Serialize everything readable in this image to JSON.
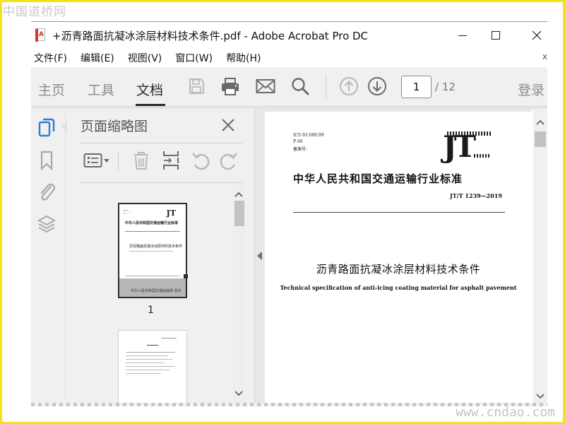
{
  "watermarks": {
    "top_left": "中国道桥网",
    "bottom_right": "www.cndao.com"
  },
  "window": {
    "title": "+沥青路面抗凝冰涂层材料技术条件.pdf - Adobe Acrobat Pro DC",
    "minimize_icon": "minimize-icon",
    "maximize_icon": "maximize-icon",
    "close_icon": "close-icon"
  },
  "menu": {
    "items": [
      "文件(F)",
      "编辑(E)",
      "视图(V)",
      "窗口(W)",
      "帮助(H)"
    ],
    "more": "x"
  },
  "toolbar": {
    "tabs": [
      "主页",
      "工具",
      "文档"
    ],
    "active_tab": "文档",
    "icons": [
      "save-icon",
      "print-icon",
      "email-icon",
      "search-icon",
      "page-up-icon",
      "page-down-icon"
    ],
    "current_page": "1",
    "page_total": "/ 12",
    "login": "登录"
  },
  "left_rail": {
    "icons": [
      "page-thumbnails-icon",
      "bookmark-icon",
      "attachment-icon",
      "layers-icon"
    ]
  },
  "thumbnail_panel": {
    "title": "页面缩略图",
    "close_icon": "close-icon",
    "tool_icons": [
      "options-menu-icon",
      "delete-icon",
      "insert-page-icon",
      "rotate-left-icon",
      "rotate-right-icon"
    ],
    "thumbnails": [
      {
        "label": "1",
        "logo": "JT",
        "heading": "中华人民共和国交通运输行业标准",
        "title": "沥青路面抗凝冰涂层材料技术条件",
        "footer": "中华人民共和国交通运输部 发布"
      },
      {
        "label": ""
      }
    ]
  },
  "document": {
    "meta_lines": [
      "ICS 93.080.99",
      "P 66",
      "备案号:"
    ],
    "logo": "JT",
    "standard_heading": "中华人民共和国交通运输行业标准",
    "standard_code": "JT/T 1239—2019",
    "title_cn": "沥青路面抗凝冰涂层材料技术条件",
    "title_en": "Technical specification of anti-icing coating material for asphalt pavement"
  },
  "colors": {
    "frame": "#f2e21a",
    "toolbar_bg": "#f0f0f0",
    "icon_grey": "#8a8a8a",
    "active_text": "#2b2b2b"
  }
}
